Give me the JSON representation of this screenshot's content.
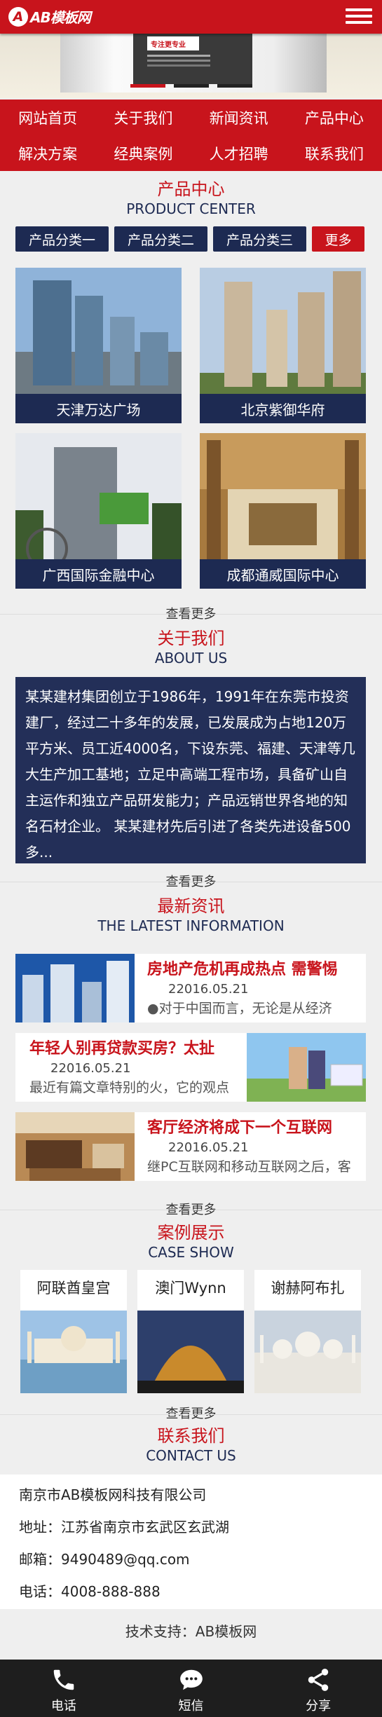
{
  "header": {
    "logo_mark": "A",
    "logo_text": "AB模板网"
  },
  "banner": {
    "card_text": "专注更专业"
  },
  "nav": [
    "网站首页",
    "关于我们",
    "新闻资讯",
    "产品中心",
    "解决方案",
    "经典案例",
    "人才招聘",
    "联系我们"
  ],
  "products": {
    "title_cn": "产品中心",
    "title_en": "PRODUCT CENTER",
    "categories": [
      "产品分类一",
      "产品分类二",
      "产品分类三"
    ],
    "more_button": "更多",
    "items": [
      "天津万达广场",
      "北京紫御华府",
      "广西国际金融中心",
      "成都通威国际中心"
    ],
    "more_link": "查看更多"
  },
  "about": {
    "title_cn": "关于我们",
    "title_en": "ABOUT US",
    "text": "某某建材集团创立于1986年，1991年在东莞市投资建厂，经过二十多年的发展，已发展成为占地120万平方米、员工近4000名，下设东莞、福建、天津等几大生产加工基地；立足中高端工程市场，具备矿山自主运作和独立产品研发能力；产品远销世界各地的知名石材企业。 某某建材先后引进了各类先进设备500多...",
    "more_link": "查看更多"
  },
  "news": {
    "title_cn": "最新资讯",
    "title_en": "THE LATEST INFORMATION",
    "items": [
      {
        "title": "房地产危机再成热点 需警惕",
        "date": "22016.05.21",
        "summary": "●对于中国而言，无论是从经济"
      },
      {
        "title": "年轻人别再贷款买房？太扯",
        "date": "22016.05.21",
        "summary": "最近有篇文章特别的火，它的观点"
      },
      {
        "title": "客厅经济将成下一个互联网",
        "date": "22016.05.21",
        "summary": "继PC互联网和移动互联网之后，客"
      }
    ],
    "more_link": "查看更多"
  },
  "cases": {
    "title_cn": "案例展示",
    "title_en": "CASE SHOW",
    "items": [
      "阿联酋皇宫",
      "澳门Wynn",
      "谢赫阿布扎"
    ],
    "more_link": "查看更多"
  },
  "contact": {
    "title_cn": "联系我们",
    "title_en": "CONTACT US",
    "company": "南京市AB模板网科技有限公司",
    "address": "地址：江苏省南京市玄武区玄武湖",
    "email": "邮箱：9490489@qq.com",
    "phone": "电话：4008-888-888"
  },
  "footer": {
    "support": "技术支持：AB模板网"
  },
  "bottom_bar": {
    "phone": "电话",
    "sms": "短信",
    "share": "分享"
  },
  "colors": {
    "brand_red": "#c8141c",
    "navy": "#1d2a52"
  }
}
